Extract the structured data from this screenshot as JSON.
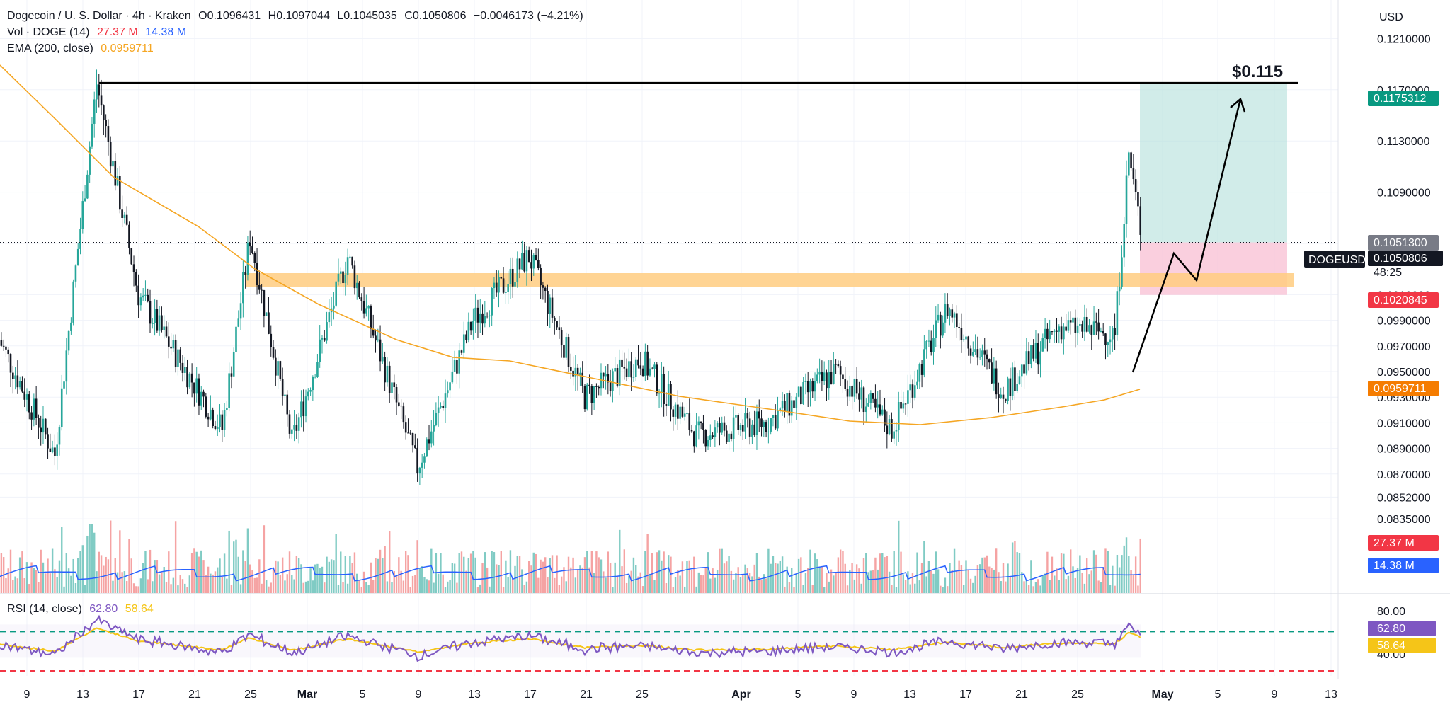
{
  "header": {
    "symbol_title": "Dogecoin / U. S. Dollar · 4h · Kraken",
    "open": "O0.1096431",
    "high": "H0.1097044",
    "low": "L0.1045035",
    "close": "C0.1050806",
    "change": "−0.0046173 (−4.21%)",
    "vol_label": "Vol · DOGE (14)",
    "vol_value": "27.37 M",
    "vol_ma_value": "14.38 M",
    "ema_label": "EMA (200, close)",
    "ema_value": "0.0959711",
    "rsi_label": "RSI (14, close)",
    "rsi_value": "62.80",
    "rsi_ma_value": "58.64"
  },
  "currency": "USD",
  "symbol_tag": "DOGEUSD",
  "countdown": "48:25",
  "target_label": "$0.115",
  "colors": {
    "up": "#26a69a",
    "down": "#131722",
    "ema": "#f5a623",
    "zone": "#ffcc80",
    "target_fill": "#b2dfdb",
    "stop_fill": "#f8bbd0",
    "vol_up": "#80cbc4",
    "vol_down": "#f5a3a3",
    "vol_ma": "#2962ff",
    "rsi": "#7e57c2",
    "rsi_ma": "#f5c518",
    "rsi_upper": "#089981",
    "rsi_lower": "#f23645"
  },
  "chart_data": {
    "type": "candlestick",
    "timeframe": "4h",
    "price_axis": [
      "0.1210000",
      "0.1170000",
      "0.1130000",
      "0.1090000",
      "0.1050000",
      "0.1010000",
      "0.0990000",
      "0.0970000",
      "0.0950000",
      "0.0930000",
      "0.0910000",
      "0.0890000",
      "0.0870000",
      "0.0852000",
      "0.0835000"
    ],
    "x_ticks": [
      "9",
      "13",
      "17",
      "21",
      "25",
      "Mar",
      "5",
      "9",
      "13",
      "17",
      "21",
      "25",
      "Apr",
      "5",
      "9",
      "13",
      "17",
      "21",
      "25",
      "May",
      "5",
      "9",
      "13"
    ],
    "price_badges": [
      {
        "label": "0.1175312",
        "color": "#089981"
      },
      {
        "label": "0.1051300",
        "color": "#787b86"
      },
      {
        "label": "0.1050806",
        "color": "#131722"
      },
      {
        "label": "0.1020845",
        "color": "#f23645"
      },
      {
        "label": "0.0959711",
        "color": "#f57c00"
      },
      {
        "label": "27.37 M",
        "color": "#f23645"
      },
      {
        "label": "14.38 M",
        "color": "#2962ff"
      }
    ],
    "rsi_axis": [
      "80.00",
      "40.00"
    ],
    "rsi_badges": [
      {
        "label": "62.80",
        "color": "#7e57c2"
      },
      {
        "label": "58.64",
        "color": "#f5c518"
      }
    ],
    "resistance_level": 0.1175312,
    "entry": 0.1050806,
    "stop": 0.1020845,
    "ema_last": 0.0959711,
    "key_points": [
      {
        "date": "Feb 7",
        "price": 0.0975
      },
      {
        "date": "Feb 11",
        "price": 0.0885
      },
      {
        "date": "Feb 14",
        "price": 0.1175
      },
      {
        "date": "Feb 17",
        "price": 0.101
      },
      {
        "date": "Feb 23",
        "price": 0.0905
      },
      {
        "date": "Feb 25",
        "price": 0.1055
      },
      {
        "date": "Feb 28",
        "price": 0.0895
      },
      {
        "date": "Mar 4",
        "price": 0.104
      },
      {
        "date": "Mar 9",
        "price": 0.0875
      },
      {
        "date": "Mar 13",
        "price": 0.099
      },
      {
        "date": "Mar 17",
        "price": 0.104
      },
      {
        "date": "Mar 21",
        "price": 0.093
      },
      {
        "date": "Mar 25",
        "price": 0.096
      },
      {
        "date": "Mar 29",
        "price": 0.09
      },
      {
        "date": "Apr 3",
        "price": 0.091
      },
      {
        "date": "Apr 8",
        "price": 0.095
      },
      {
        "date": "Apr 12",
        "price": 0.0905
      },
      {
        "date": "Apr 16",
        "price": 0.1
      },
      {
        "date": "Apr 20",
        "price": 0.0935
      },
      {
        "date": "Apr 24",
        "price": 0.0985
      },
      {
        "date": "Apr 28",
        "price": 0.098
      },
      {
        "date": "Apr 29",
        "price": 0.112
      },
      {
        "date": "Apr 30",
        "price": 0.1051
      }
    ]
  }
}
